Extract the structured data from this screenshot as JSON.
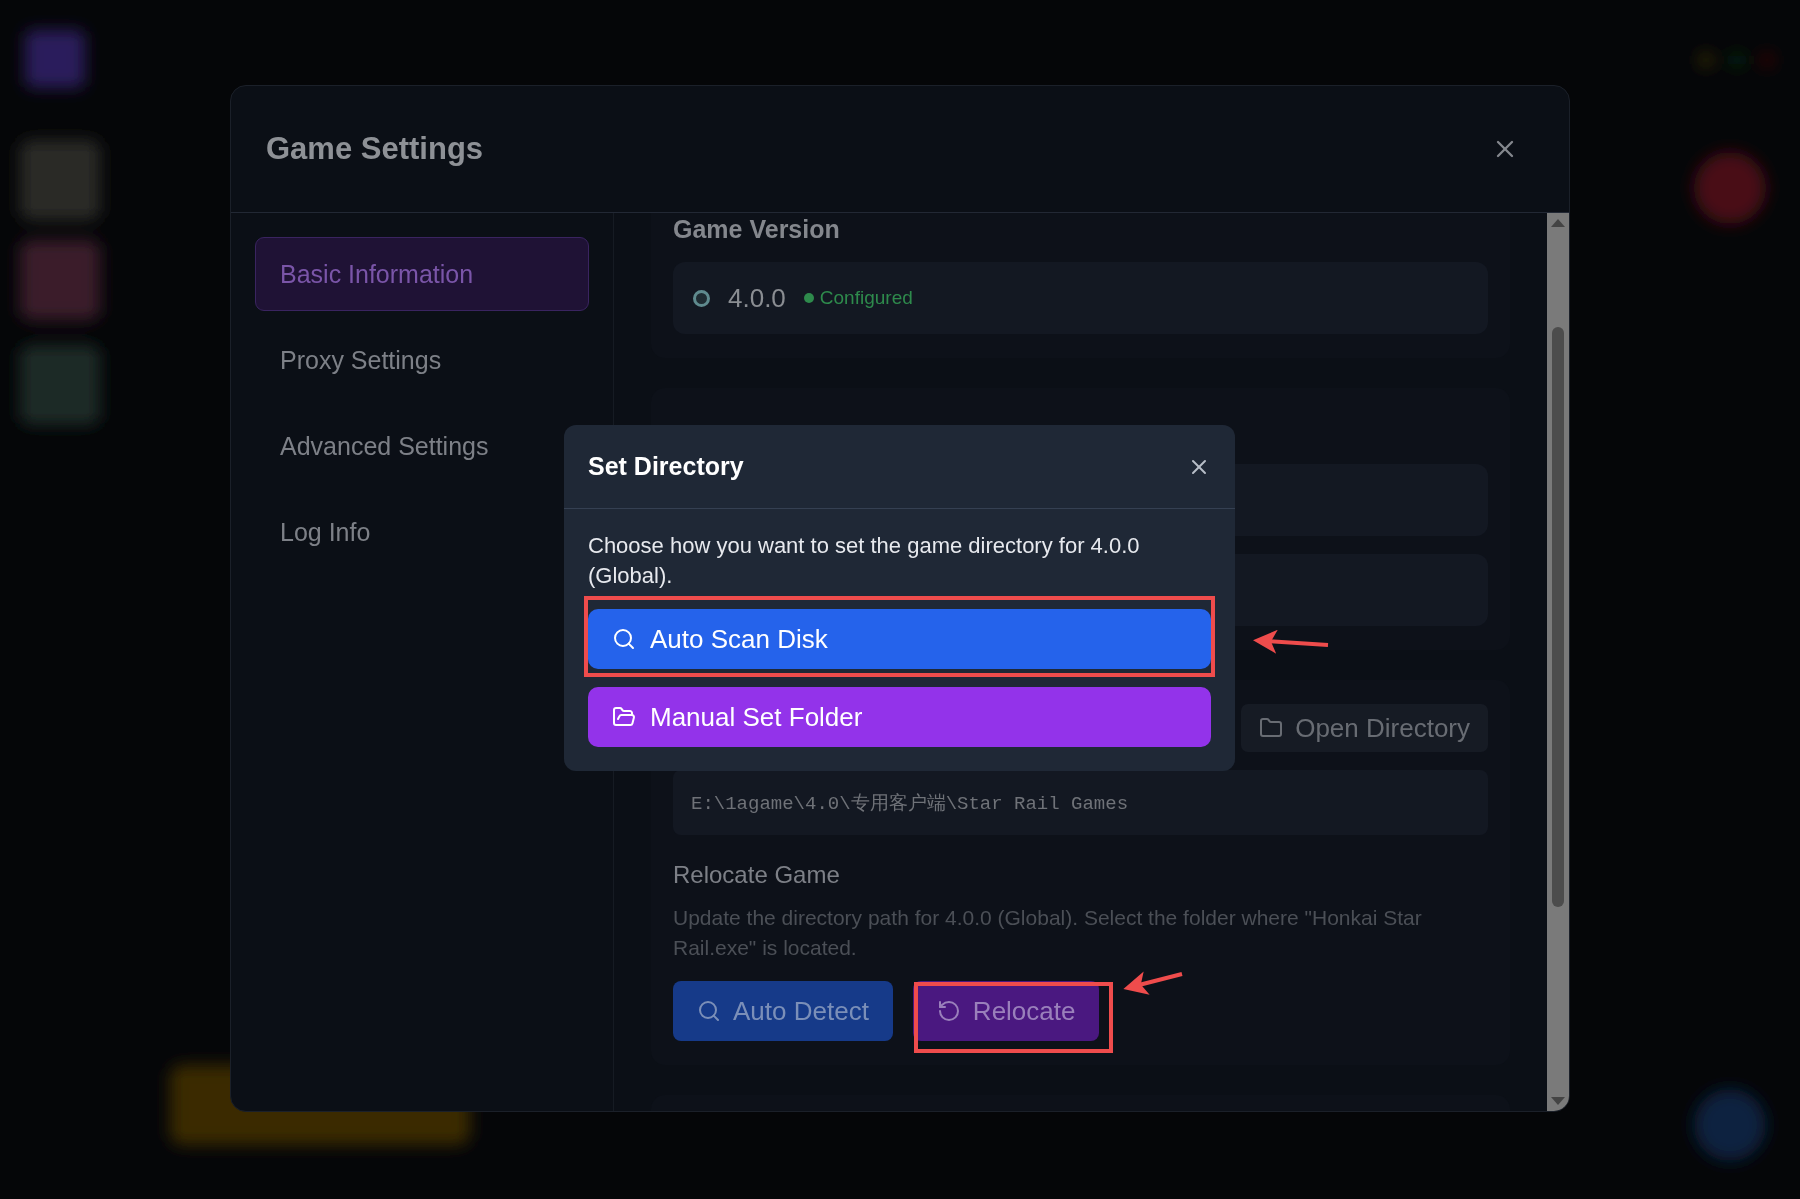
{
  "settings_dialog": {
    "title": "Game Settings",
    "sidebar": [
      {
        "label": "Basic Information",
        "selected": true
      },
      {
        "label": "Proxy Settings",
        "selected": false
      },
      {
        "label": "Advanced Settings",
        "selected": false
      },
      {
        "label": "Log Info",
        "selected": false
      }
    ],
    "game_version": {
      "heading": "Game Version",
      "version": "4.0.0",
      "status": "Configured"
    },
    "directory": {
      "open_button": "Open Directory",
      "path": "E:\\1agame\\4.0\\专用客户端\\Star Rail Games"
    },
    "relocate": {
      "heading": "Relocate Game",
      "description": "Update the directory path for 4.0.0 (Global). Select the folder where \"Honkai Star Rail.exe\" is located.",
      "buttons": [
        {
          "label": "Auto Detect",
          "kind": "detect"
        },
        {
          "label": "Relocate",
          "kind": "relocate"
        }
      ]
    }
  },
  "set_directory_dialog": {
    "title": "Set Directory",
    "message": "Choose how you want to set the game directory for 4.0.0 (Global).",
    "options": [
      {
        "label": "Auto Scan Disk",
        "kind": "scan"
      },
      {
        "label": "Manual Set Folder",
        "kind": "folder"
      }
    ]
  }
}
